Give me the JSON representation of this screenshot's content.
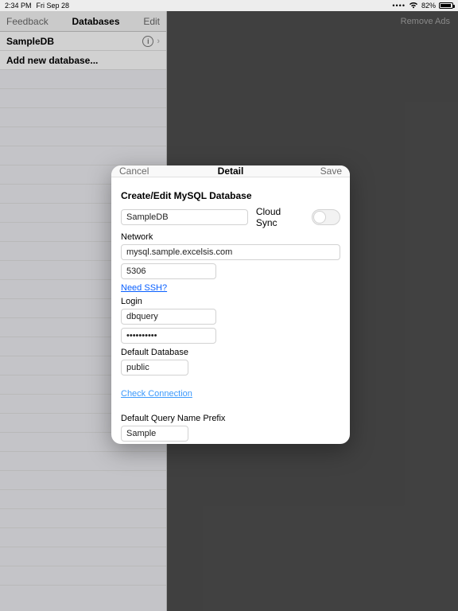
{
  "statusbar": {
    "time": "2:34 PM",
    "date": "Fri Sep 28",
    "battery_pct": "82%"
  },
  "leftpanel": {
    "feedback": "Feedback",
    "title": "Databases",
    "edit": "Edit",
    "row1": "SampleDB",
    "row2": "Add new database..."
  },
  "rightheader": {
    "remove_ads": "Remove Ads"
  },
  "modal": {
    "cancel": "Cancel",
    "title": "Detail",
    "save": "Save",
    "section_title": "Create/Edit MySQL Database",
    "name_value": "SampleDB",
    "cloud_sync_label": "Cloud Sync",
    "network_label": "Network",
    "host_value": "mysql.sample.excelsis.com",
    "port_value": "5306",
    "need_ssh": "Need SSH?",
    "login_label": "Login",
    "login_user": "dbquery",
    "login_pass": "••••••••••",
    "default_db_label": "Default Database",
    "default_db_value": "public",
    "check_conn": "Check Connection",
    "prefix_label": "Default Query Name Prefix",
    "prefix_value": "Sample"
  }
}
